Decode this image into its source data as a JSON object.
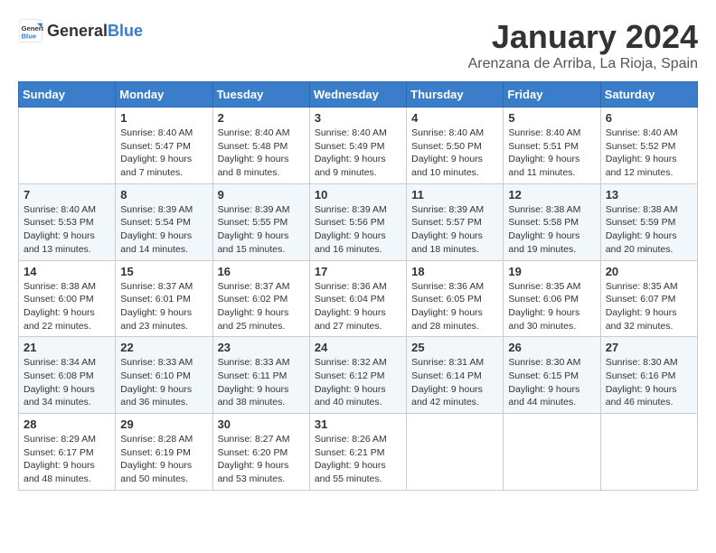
{
  "header": {
    "logo_general": "General",
    "logo_blue": "Blue",
    "title": "January 2024",
    "subtitle": "Arenzana de Arriba, La Rioja, Spain"
  },
  "columns": [
    "Sunday",
    "Monday",
    "Tuesday",
    "Wednesday",
    "Thursday",
    "Friday",
    "Saturday"
  ],
  "weeks": [
    [
      {
        "day": "",
        "info": ""
      },
      {
        "day": "1",
        "info": "Sunrise: 8:40 AM\nSunset: 5:47 PM\nDaylight: 9 hours\nand 7 minutes."
      },
      {
        "day": "2",
        "info": "Sunrise: 8:40 AM\nSunset: 5:48 PM\nDaylight: 9 hours\nand 8 minutes."
      },
      {
        "day": "3",
        "info": "Sunrise: 8:40 AM\nSunset: 5:49 PM\nDaylight: 9 hours\nand 9 minutes."
      },
      {
        "day": "4",
        "info": "Sunrise: 8:40 AM\nSunset: 5:50 PM\nDaylight: 9 hours\nand 10 minutes."
      },
      {
        "day": "5",
        "info": "Sunrise: 8:40 AM\nSunset: 5:51 PM\nDaylight: 9 hours\nand 11 minutes."
      },
      {
        "day": "6",
        "info": "Sunrise: 8:40 AM\nSunset: 5:52 PM\nDaylight: 9 hours\nand 12 minutes."
      }
    ],
    [
      {
        "day": "7",
        "info": "Sunrise: 8:40 AM\nSunset: 5:53 PM\nDaylight: 9 hours\nand 13 minutes."
      },
      {
        "day": "8",
        "info": "Sunrise: 8:39 AM\nSunset: 5:54 PM\nDaylight: 9 hours\nand 14 minutes."
      },
      {
        "day": "9",
        "info": "Sunrise: 8:39 AM\nSunset: 5:55 PM\nDaylight: 9 hours\nand 15 minutes."
      },
      {
        "day": "10",
        "info": "Sunrise: 8:39 AM\nSunset: 5:56 PM\nDaylight: 9 hours\nand 16 minutes."
      },
      {
        "day": "11",
        "info": "Sunrise: 8:39 AM\nSunset: 5:57 PM\nDaylight: 9 hours\nand 18 minutes."
      },
      {
        "day": "12",
        "info": "Sunrise: 8:38 AM\nSunset: 5:58 PM\nDaylight: 9 hours\nand 19 minutes."
      },
      {
        "day": "13",
        "info": "Sunrise: 8:38 AM\nSunset: 5:59 PM\nDaylight: 9 hours\nand 20 minutes."
      }
    ],
    [
      {
        "day": "14",
        "info": "Sunrise: 8:38 AM\nSunset: 6:00 PM\nDaylight: 9 hours\nand 22 minutes."
      },
      {
        "day": "15",
        "info": "Sunrise: 8:37 AM\nSunset: 6:01 PM\nDaylight: 9 hours\nand 23 minutes."
      },
      {
        "day": "16",
        "info": "Sunrise: 8:37 AM\nSunset: 6:02 PM\nDaylight: 9 hours\nand 25 minutes."
      },
      {
        "day": "17",
        "info": "Sunrise: 8:36 AM\nSunset: 6:04 PM\nDaylight: 9 hours\nand 27 minutes."
      },
      {
        "day": "18",
        "info": "Sunrise: 8:36 AM\nSunset: 6:05 PM\nDaylight: 9 hours\nand 28 minutes."
      },
      {
        "day": "19",
        "info": "Sunrise: 8:35 AM\nSunset: 6:06 PM\nDaylight: 9 hours\nand 30 minutes."
      },
      {
        "day": "20",
        "info": "Sunrise: 8:35 AM\nSunset: 6:07 PM\nDaylight: 9 hours\nand 32 minutes."
      }
    ],
    [
      {
        "day": "21",
        "info": "Sunrise: 8:34 AM\nSunset: 6:08 PM\nDaylight: 9 hours\nand 34 minutes."
      },
      {
        "day": "22",
        "info": "Sunrise: 8:33 AM\nSunset: 6:10 PM\nDaylight: 9 hours\nand 36 minutes."
      },
      {
        "day": "23",
        "info": "Sunrise: 8:33 AM\nSunset: 6:11 PM\nDaylight: 9 hours\nand 38 minutes."
      },
      {
        "day": "24",
        "info": "Sunrise: 8:32 AM\nSunset: 6:12 PM\nDaylight: 9 hours\nand 40 minutes."
      },
      {
        "day": "25",
        "info": "Sunrise: 8:31 AM\nSunset: 6:14 PM\nDaylight: 9 hours\nand 42 minutes."
      },
      {
        "day": "26",
        "info": "Sunrise: 8:30 AM\nSunset: 6:15 PM\nDaylight: 9 hours\nand 44 minutes."
      },
      {
        "day": "27",
        "info": "Sunrise: 8:30 AM\nSunset: 6:16 PM\nDaylight: 9 hours\nand 46 minutes."
      }
    ],
    [
      {
        "day": "28",
        "info": "Sunrise: 8:29 AM\nSunset: 6:17 PM\nDaylight: 9 hours\nand 48 minutes."
      },
      {
        "day": "29",
        "info": "Sunrise: 8:28 AM\nSunset: 6:19 PM\nDaylight: 9 hours\nand 50 minutes."
      },
      {
        "day": "30",
        "info": "Sunrise: 8:27 AM\nSunset: 6:20 PM\nDaylight: 9 hours\nand 53 minutes."
      },
      {
        "day": "31",
        "info": "Sunrise: 8:26 AM\nSunset: 6:21 PM\nDaylight: 9 hours\nand 55 minutes."
      },
      {
        "day": "",
        "info": ""
      },
      {
        "day": "",
        "info": ""
      },
      {
        "day": "",
        "info": ""
      }
    ]
  ]
}
